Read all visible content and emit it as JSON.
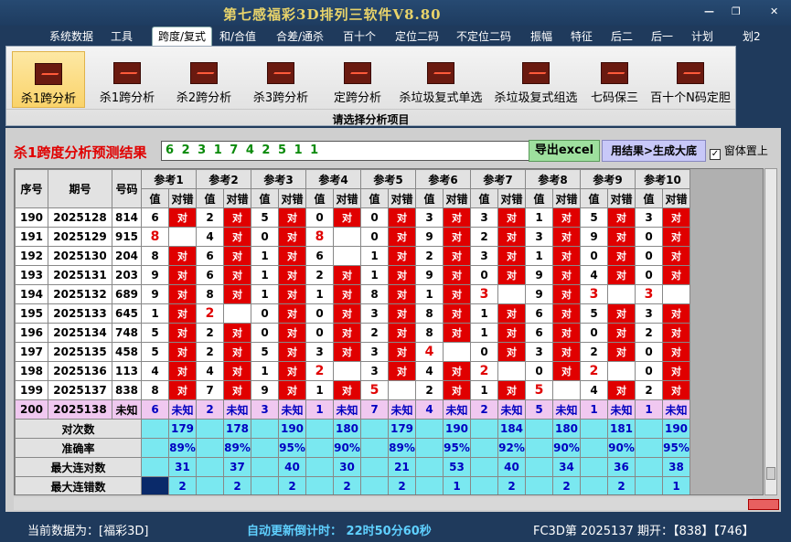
{
  "app": {
    "title": "第七感福彩3D排列三软件V8.80",
    "min_label": "—",
    "max_label": "❐",
    "close_label": "✕"
  },
  "menu": [
    "系统数据",
    "工具",
    "跨度/复式",
    "和/合值",
    "合差/通杀",
    "百十个",
    "定位二码",
    "不定位二码",
    "振幅",
    "特征",
    "后二",
    "后一",
    "计划",
    "划2"
  ],
  "menu_active": 2,
  "ribbon": {
    "buttons": [
      "杀1跨分析",
      "杀1跨分析",
      "杀2跨分析",
      "杀3跨分析",
      "定跨分析",
      "杀垃圾复式单选",
      "杀垃圾复式组选",
      "七码保三",
      "百十个N码定胆"
    ],
    "group_label": "请选择分析项目"
  },
  "result": {
    "label": "杀1跨度分析预测结果",
    "value": "6 2 3 1 7 4 2 5 1 1",
    "export_label": "导出excel",
    "generate_label": "用结果>生成大底",
    "ontop_label": "窗体置上",
    "ontop_checked": "✓"
  },
  "table": {
    "head_fixed": [
      "序号",
      "期号",
      "号码"
    ],
    "refs": [
      "参考1",
      "参考2",
      "参考3",
      "参考4",
      "参考5",
      "参考6",
      "参考7",
      "参考8",
      "参考9",
      "参考10"
    ],
    "sub": [
      "值",
      "对错"
    ],
    "rows": [
      {
        "seq": "190",
        "period": "2025128",
        "num": "814",
        "cells": [
          [
            "6",
            "对"
          ],
          [
            "2",
            "对"
          ],
          [
            "5",
            "对"
          ],
          [
            "0",
            "对"
          ],
          [
            "0",
            "对"
          ],
          [
            "3",
            "对"
          ],
          [
            "3",
            "对"
          ],
          [
            "1",
            "对"
          ],
          [
            "5",
            "对"
          ],
          [
            "3",
            "对"
          ]
        ],
        "big": []
      },
      {
        "seq": "191",
        "period": "2025129",
        "num": "915",
        "cells": [
          [
            "8",
            ""
          ],
          [
            "4",
            "对"
          ],
          [
            "0",
            "对"
          ],
          [
            "8",
            ""
          ],
          [
            "0",
            "对"
          ],
          [
            "9",
            "对"
          ],
          [
            "2",
            "对"
          ],
          [
            "3",
            "对"
          ],
          [
            "9",
            "对"
          ],
          [
            "0",
            "对"
          ]
        ],
        "big": [
          0,
          3
        ]
      },
      {
        "seq": "192",
        "period": "2025130",
        "num": "204",
        "cells": [
          [
            "8",
            "对"
          ],
          [
            "6",
            "对"
          ],
          [
            "1",
            "对"
          ],
          [
            "6",
            ""
          ],
          [
            "1",
            "对"
          ],
          [
            "2",
            "对"
          ],
          [
            "3",
            "对"
          ],
          [
            "1",
            "对"
          ],
          [
            "0",
            "对"
          ],
          [
            "0",
            "对"
          ]
        ],
        "big": []
      },
      {
        "seq": "193",
        "period": "2025131",
        "num": "203",
        "cells": [
          [
            "9",
            "对"
          ],
          [
            "6",
            "对"
          ],
          [
            "1",
            "对"
          ],
          [
            "2",
            "对"
          ],
          [
            "1",
            "对"
          ],
          [
            "9",
            "对"
          ],
          [
            "0",
            "对"
          ],
          [
            "9",
            "对"
          ],
          [
            "4",
            "对"
          ],
          [
            "0",
            "对"
          ]
        ],
        "big": []
      },
      {
        "seq": "194",
        "period": "2025132",
        "num": "689",
        "cells": [
          [
            "9",
            "对"
          ],
          [
            "8",
            "对"
          ],
          [
            "1",
            "对"
          ],
          [
            "1",
            "对"
          ],
          [
            "8",
            "对"
          ],
          [
            "1",
            "对"
          ],
          [
            "3",
            ""
          ],
          [
            "9",
            "对"
          ],
          [
            "3",
            ""
          ],
          [
            "3",
            ""
          ]
        ],
        "big": [
          6,
          8,
          9
        ]
      },
      {
        "seq": "195",
        "period": "2025133",
        "num": "645",
        "cells": [
          [
            "1",
            "对"
          ],
          [
            "2",
            ""
          ],
          [
            "0",
            "对"
          ],
          [
            "0",
            "对"
          ],
          [
            "3",
            "对"
          ],
          [
            "8",
            "对"
          ],
          [
            "1",
            "对"
          ],
          [
            "6",
            "对"
          ],
          [
            "5",
            "对"
          ],
          [
            "3",
            "对"
          ]
        ],
        "big": [
          1
        ]
      },
      {
        "seq": "196",
        "period": "2025134",
        "num": "748",
        "cells": [
          [
            "5",
            "对"
          ],
          [
            "2",
            "对"
          ],
          [
            "0",
            "对"
          ],
          [
            "0",
            "对"
          ],
          [
            "2",
            "对"
          ],
          [
            "8",
            "对"
          ],
          [
            "1",
            "对"
          ],
          [
            "6",
            "对"
          ],
          [
            "0",
            "对"
          ],
          [
            "2",
            "对"
          ]
        ],
        "big": []
      },
      {
        "seq": "197",
        "period": "2025135",
        "num": "458",
        "cells": [
          [
            "5",
            "对"
          ],
          [
            "2",
            "对"
          ],
          [
            "5",
            "对"
          ],
          [
            "3",
            "对"
          ],
          [
            "3",
            "对"
          ],
          [
            "4",
            ""
          ],
          [
            "0",
            "对"
          ],
          [
            "3",
            "对"
          ],
          [
            "2",
            "对"
          ],
          [
            "0",
            "对"
          ]
        ],
        "big": [
          5
        ]
      },
      {
        "seq": "198",
        "period": "2025136",
        "num": "113",
        "cells": [
          [
            "4",
            "对"
          ],
          [
            "4",
            "对"
          ],
          [
            "1",
            "对"
          ],
          [
            "2",
            ""
          ],
          [
            "3",
            "对"
          ],
          [
            "4",
            "对"
          ],
          [
            "2",
            ""
          ],
          [
            "0",
            "对"
          ],
          [
            "2",
            ""
          ],
          [
            "0",
            "对"
          ]
        ],
        "big": [
          3,
          6,
          8
        ]
      },
      {
        "seq": "199",
        "period": "2025137",
        "num": "838",
        "cells": [
          [
            "8",
            "对"
          ],
          [
            "7",
            "对"
          ],
          [
            "9",
            "对"
          ],
          [
            "1",
            "对"
          ],
          [
            "5",
            ""
          ],
          [
            "2",
            "对"
          ],
          [
            "1",
            "对"
          ],
          [
            "5",
            ""
          ],
          [
            "4",
            "对"
          ],
          [
            "2",
            "对"
          ]
        ],
        "big": [
          4,
          7
        ]
      }
    ],
    "unknown": {
      "seq": "200",
      "period": "2025138",
      "num": "未知",
      "cells": [
        [
          "6",
          "未知"
        ],
        [
          "2",
          "未知"
        ],
        [
          "3",
          "未知"
        ],
        [
          "1",
          "未知"
        ],
        [
          "7",
          "未知"
        ],
        [
          "4",
          "未知"
        ],
        [
          "2",
          "未知"
        ],
        [
          "5",
          "未知"
        ],
        [
          "1",
          "未知"
        ],
        [
          "1",
          "未知"
        ]
      ]
    },
    "stats": [
      {
        "label": "对次数",
        "values": [
          "179",
          "178",
          "190",
          "180",
          "179",
          "190",
          "184",
          "180",
          "181",
          "190"
        ]
      },
      {
        "label": "准确率",
        "values": [
          "89%",
          "89%",
          "95%",
          "90%",
          "89%",
          "95%",
          "92%",
          "90%",
          "90%",
          "95%"
        ]
      },
      {
        "label": "最大连对数",
        "values": [
          "31",
          "37",
          "40",
          "30",
          "21",
          "53",
          "40",
          "34",
          "36",
          "38"
        ]
      },
      {
        "label": "最大连错数",
        "values": [
          "2",
          "2",
          "2",
          "2",
          "2",
          "1",
          "2",
          "2",
          "2",
          "1"
        ]
      }
    ]
  },
  "status": {
    "current": "当前数据为：[福彩3D]",
    "countdown": "自动更新倒计时：  22时50分60秒",
    "draw": "FC3D第 2025137 期开：【838】【746】"
  },
  "colors": {
    "hit": "#e00000",
    "stat_bg": "#7ae8f0",
    "unknown_bg": "#f0c8f0",
    "title": "#e8d36a"
  }
}
